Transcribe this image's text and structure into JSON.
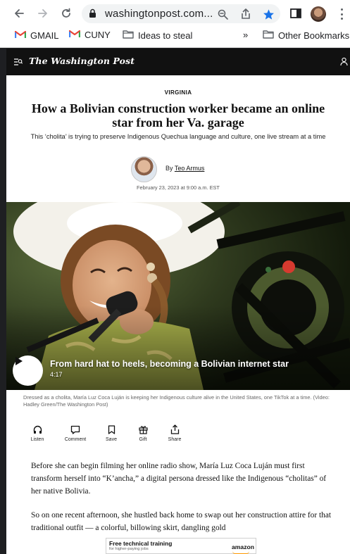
{
  "browser": {
    "url": "washingtonpost.com...",
    "icons": [
      "back-arrow-icon",
      "forward-arrow-icon",
      "reload-icon",
      "lock-icon",
      "zoom-icon",
      "share-icon",
      "star-icon",
      "sidebar-icon",
      "profile-avatar",
      "more-icon"
    ],
    "accent": "#1a73e8"
  },
  "bookmarks": {
    "items": [
      {
        "label": "GMAIL",
        "icon": "gmail-icon"
      },
      {
        "label": "CUNY",
        "icon": "gmail-icon"
      },
      {
        "label": "Ideas to steal",
        "icon": "folder-icon"
      }
    ],
    "overflow": "»",
    "other": "Other Bookmarks"
  },
  "site": {
    "logo": "The Washington Post",
    "header_bg": "#111111"
  },
  "article": {
    "kicker": "VIRGINIA",
    "headline": "How a Bolivian construction worker became an online star from her Va. garage",
    "dek": "This ‘cholita’ is trying to preserve Indigenous Quechua language and culture, one live stream at a time",
    "byline_prefix": "By",
    "author": "Teo Armus",
    "date": "February 23, 2023 at 9:00 a.m. EST",
    "video": {
      "title": "From hard hat to heels, becoming a Bolivian internet star",
      "duration": "4:17"
    },
    "caption": "Dressed as a cholita, María Luz Coca Luján is keeping her Indigenous culture alive in the United States, one TikTok at a time. (Video: Hadley Green/The Washington Post)",
    "tools": [
      {
        "label": "Listen",
        "icon": "headphones-icon"
      },
      {
        "label": "Comment",
        "icon": "comment-icon"
      },
      {
        "label": "Save",
        "icon": "bookmark-icon"
      },
      {
        "label": "Gift",
        "icon": "gift-icon"
      },
      {
        "label": "Share",
        "icon": "share-icon"
      }
    ],
    "paragraphs": [
      "Before she can begin filming her online radio show, María Luz Coca Luján must first transform herself into “K’ancha,” a digital persona dressed like the Indigenous “cholitas” of her native Bolivia.",
      "So on one recent afternoon, she hustled back home to swap out her construction attire for that traditional outfit — a colorful, billowing skirt, dangling gold"
    ]
  },
  "ad": {
    "title": "Free technical training",
    "subtitle": "for higher-paying jobs",
    "brand": "amazon",
    "brand_accent": "#ff9900"
  }
}
